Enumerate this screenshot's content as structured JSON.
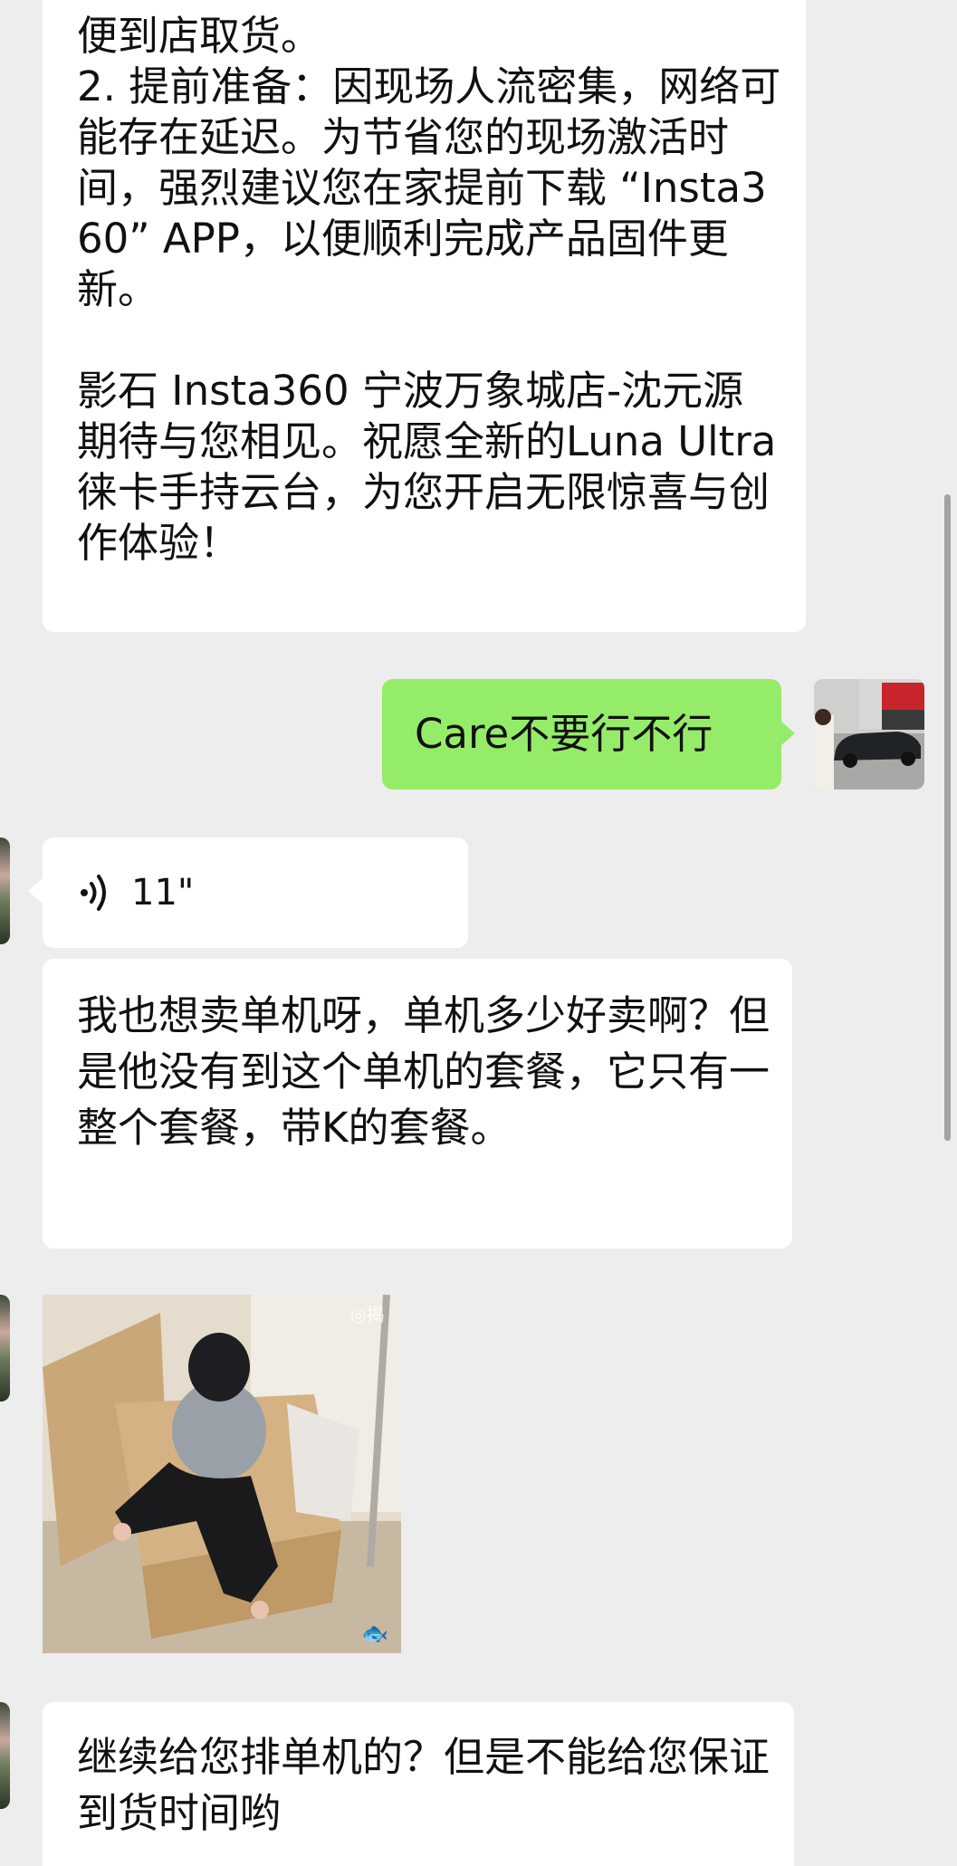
{
  "messages": {
    "store_notice": "便到店取货。\n2. 提前准备：因现场人流密集，网络可能存在延迟。为节省您的现场激活时间，强烈建议您在家提前下载 “Insta360” APP，以便顺利完成产品固件更新。\n\n影石 Insta360 宁波万象城店-沈元源期待与您相见。祝愿全新的Luna Ultra徕卡手持云台，为您开启无限惊喜与创作体验！",
    "my_reply": "Care不要行不行",
    "voice_duration": "11\"",
    "reply_single_unit": "我也想卖单机呀，单机多少好卖啊？但是他没有到这个单机的套餐，它只有一整个套餐，带K的套餐。",
    "last_message": "继续给您排单机的？但是不能给您保证到货时间哟"
  },
  "image_overlay": {
    "watermark": "◎揭"
  },
  "icons": {
    "voice": "voice-wave-icon",
    "fish": "fish-sticker-icon"
  },
  "colors": {
    "background": "#ededed",
    "incoming_bubble": "#ffffff",
    "outgoing_bubble": "#95ec69",
    "text": "#111111"
  }
}
